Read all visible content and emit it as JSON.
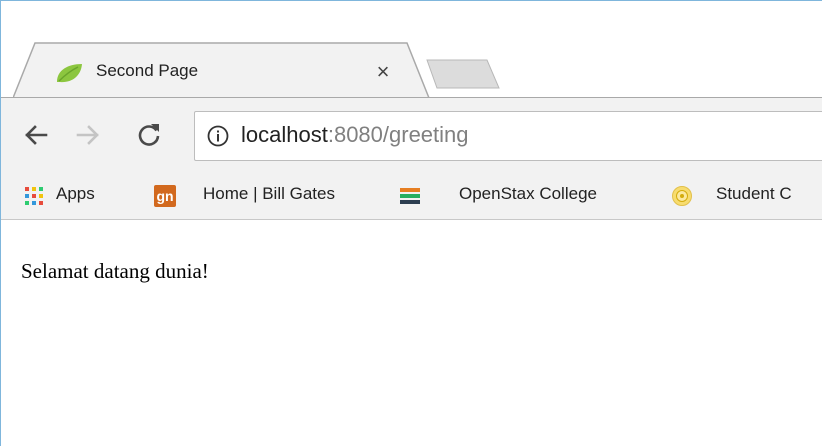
{
  "tab": {
    "title": "Second Page",
    "close_glyph": "×",
    "favicon": "spring-leaf-icon"
  },
  "toolbar": {
    "back_icon": "back-arrow-icon",
    "forward_icon": "forward-arrow-icon",
    "reload_icon": "reload-icon",
    "url_host": "localhost",
    "url_rest": ":8080/greeting",
    "info_icon": "info-icon"
  },
  "bookmarks": {
    "items": [
      {
        "label": "Apps",
        "icon": "apps-grid-icon"
      },
      {
        "label": "Home | Bill Gates",
        "icon": "gn-icon",
        "icon_text": "gn"
      },
      {
        "label": "OpenStax College",
        "icon": "openstax-icon"
      },
      {
        "label": "Student C",
        "icon": "seal-icon"
      }
    ]
  },
  "page": {
    "greeting": "Selamat datang dunia!"
  },
  "colors": {
    "toolbar_bg": "#f2f2f2",
    "favicon_green": "#8cc63f",
    "gn_orange": "#d2691e",
    "window_border": "#7fb6dc"
  }
}
